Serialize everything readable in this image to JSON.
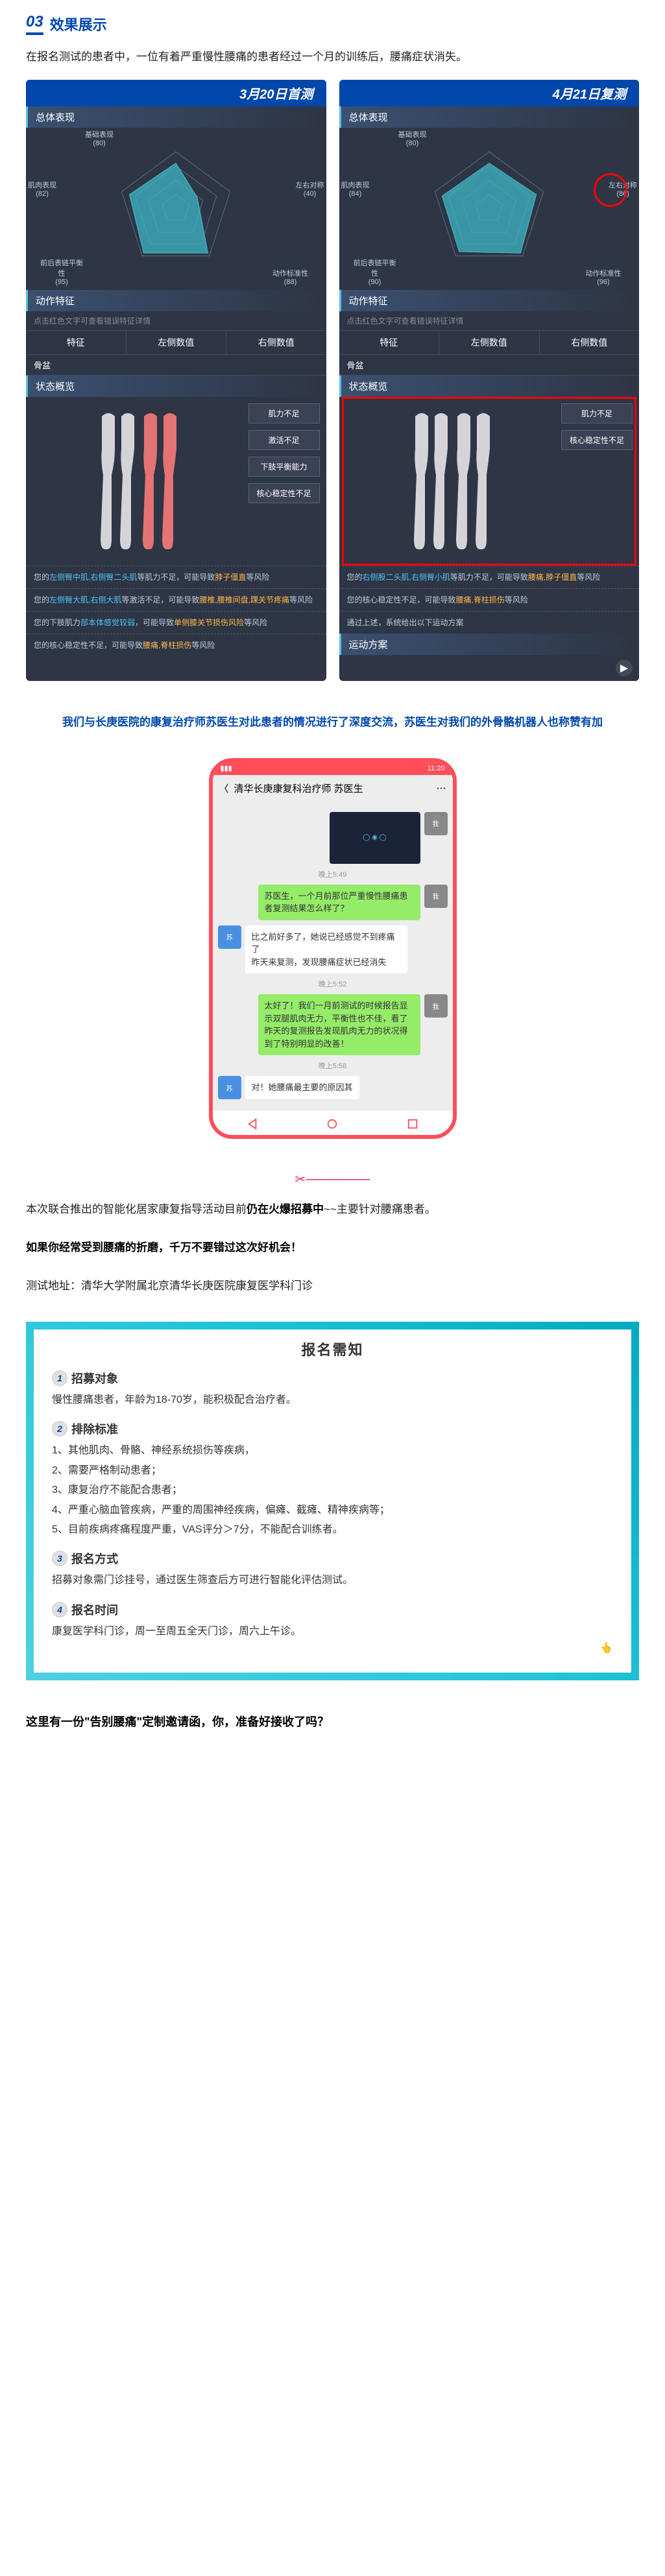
{
  "section": {
    "num": "03",
    "title": "效果展示"
  },
  "intro": "在报名测试的患者中，一位有着严重慢性腰痛的患者经过一个月的训练后，腰痛症状消失。",
  "panel_left": {
    "date": "3月20日首测",
    "overall_title": "总体表现",
    "radar_labels": [
      {
        "t": "基础表现",
        "s": "(80)"
      },
      {
        "t": "左右对称",
        "s": "(40)"
      },
      {
        "t": "动作标准性",
        "s": "(88)"
      },
      {
        "t": "前后表链平衡性",
        "s": "(95)"
      },
      {
        "t": "肌肉表现",
        "s": "(82)"
      }
    ],
    "action_title": "动作特征",
    "action_note": "点击红色文字可查看错误特征详情",
    "tabs": [
      "特征",
      "左侧数值",
      "右侧数值"
    ],
    "subrow": "骨盆",
    "status_title": "状态概览",
    "atags": [
      "肌力不足",
      "激活不足",
      "下肢平衡能力",
      "核心稳定性不足"
    ],
    "findings": [
      {
        "pre": "您的",
        "kw1": "左侧臀中肌,右侧臀二头肌",
        "mid": "等肌力不足，可能导致",
        "kw2": "脖子僵直",
        "suf": "等风险"
      },
      {
        "pre": "您的",
        "kw1": "左侧臀大肌,右侧大肌",
        "mid": "等激活不足，可能导致",
        "kw2": "腰椎,腰椎间盘,踝关节疼痛",
        "suf": "等风险"
      },
      {
        "pre": "您的下肢肌力",
        "kw1": "部本体感觉较弱",
        "mid": "，可能导致",
        "kw2": "单侧膝关节损伤风险",
        "suf": "等风险"
      },
      {
        "pre": "您的核心稳定性不足，可能导致",
        "kw1": "",
        "mid": "",
        "kw2": "腰痛,脊柱损伤",
        "suf": "等风险"
      }
    ]
  },
  "panel_right": {
    "date": "4月21日复测",
    "overall_title": "总体表现",
    "radar_labels": [
      {
        "t": "基础表现",
        "s": "(80)"
      },
      {
        "t": "左右对称",
        "s": "(86)"
      },
      {
        "t": "动作标准性",
        "s": "(96)"
      },
      {
        "t": "前后表链平衡性",
        "s": "(90)"
      },
      {
        "t": "肌肉表现",
        "s": "(84)"
      }
    ],
    "action_title": "动作特征",
    "action_note": "点击红色文字可查看错误特征详情",
    "tabs": [
      "特征",
      "左侧数值",
      "右侧数值"
    ],
    "subrow": "骨盆",
    "status_title": "状态概览",
    "atags": [
      "肌力不足",
      "核心稳定性不足"
    ],
    "findings": [
      {
        "pre": "您的",
        "kw1": "右侧股二头肌,右侧臀小肌",
        "mid": "等肌力不足，可能导致",
        "kw2": "腰痛,脖子僵直",
        "suf": "等风险"
      },
      {
        "pre": "您的核心稳定性不足，可能导致",
        "kw1": "",
        "mid": "",
        "kw2": "腰痛,脊柱损伤",
        "suf": "等风险"
      },
      {
        "pre": "通过上述，系统给出以下运动方案",
        "kw1": "",
        "mid": "",
        "kw2": "",
        "suf": ""
      }
    ],
    "plan_title": "运动方案"
  },
  "mid_text": "我们与长庚医院的康复治疗师苏医生对此患者的情况进行了深度交流，苏医生对我们的外骨骼机器人也称赞有加",
  "phone": {
    "time": "11:20",
    "header": "清华长庚康复科治疗师  苏医生",
    "ts1": "晚上5:49",
    "m1": "苏医生，一个月前那位严重慢性腰痛患者复测结果怎么样了？",
    "m2": "比之前好多了，她说已经感觉不到疼痛了\n昨天来复测，发现腰痛症状已经消失",
    "ts2": "晚上5:52",
    "m3": "太好了！我们一月前测试的时候报告显示双腿肌肉无力，平衡性也不佳，看了昨天的复测报告发现肌肉无力的状况得到了特别明显的改善！",
    "ts3": "晚上5:58",
    "m4": "对！她腰痛最主要的原因其"
  },
  "signup_intro1": "本次联合推出的智能化居家康复指导活动目前仍在火爆招募中~~主要针对腰痛患者。",
  "signup_intro2": "如果你经常受到腰痛的折磨，千万不要错过这次好机会！",
  "signup_loc": "测试地址：清华大学附属北京清华长庚医院康复医学科门诊",
  "signup": {
    "title": "报名需知",
    "s1": {
      "n": "1",
      "t": "招募对象",
      "b": "慢性腰痛患者，年龄为18-70岁，能积极配合治疗者。"
    },
    "s2": {
      "n": "2",
      "t": "排除标准",
      "items": [
        "1、其他肌肉、骨骼、神经系统损伤等疾病，",
        "2、需要严格制动患者；",
        "3、康复治疗不能配合患者；",
        "4、严重心脑血管疾病，严重的周围神经疾病，偏瘫、截瘫、精神疾病等；",
        "5、目前疾病疼痛程度严重，VAS评分＞7分，不能配合训练者。"
      ]
    },
    "s3": {
      "n": "3",
      "t": "报名方式",
      "b": "招募对象需门诊挂号，通过医生筛查后方可进行智能化评估测试。"
    },
    "s4": {
      "n": "4",
      "t": "报名时间",
      "b": "康复医学科门诊，周一至周五全天门诊，周六上午诊。"
    }
  },
  "closing": "这里有一份\"告别腰痛\"定制邀请函，你，准备好接收了吗？"
}
